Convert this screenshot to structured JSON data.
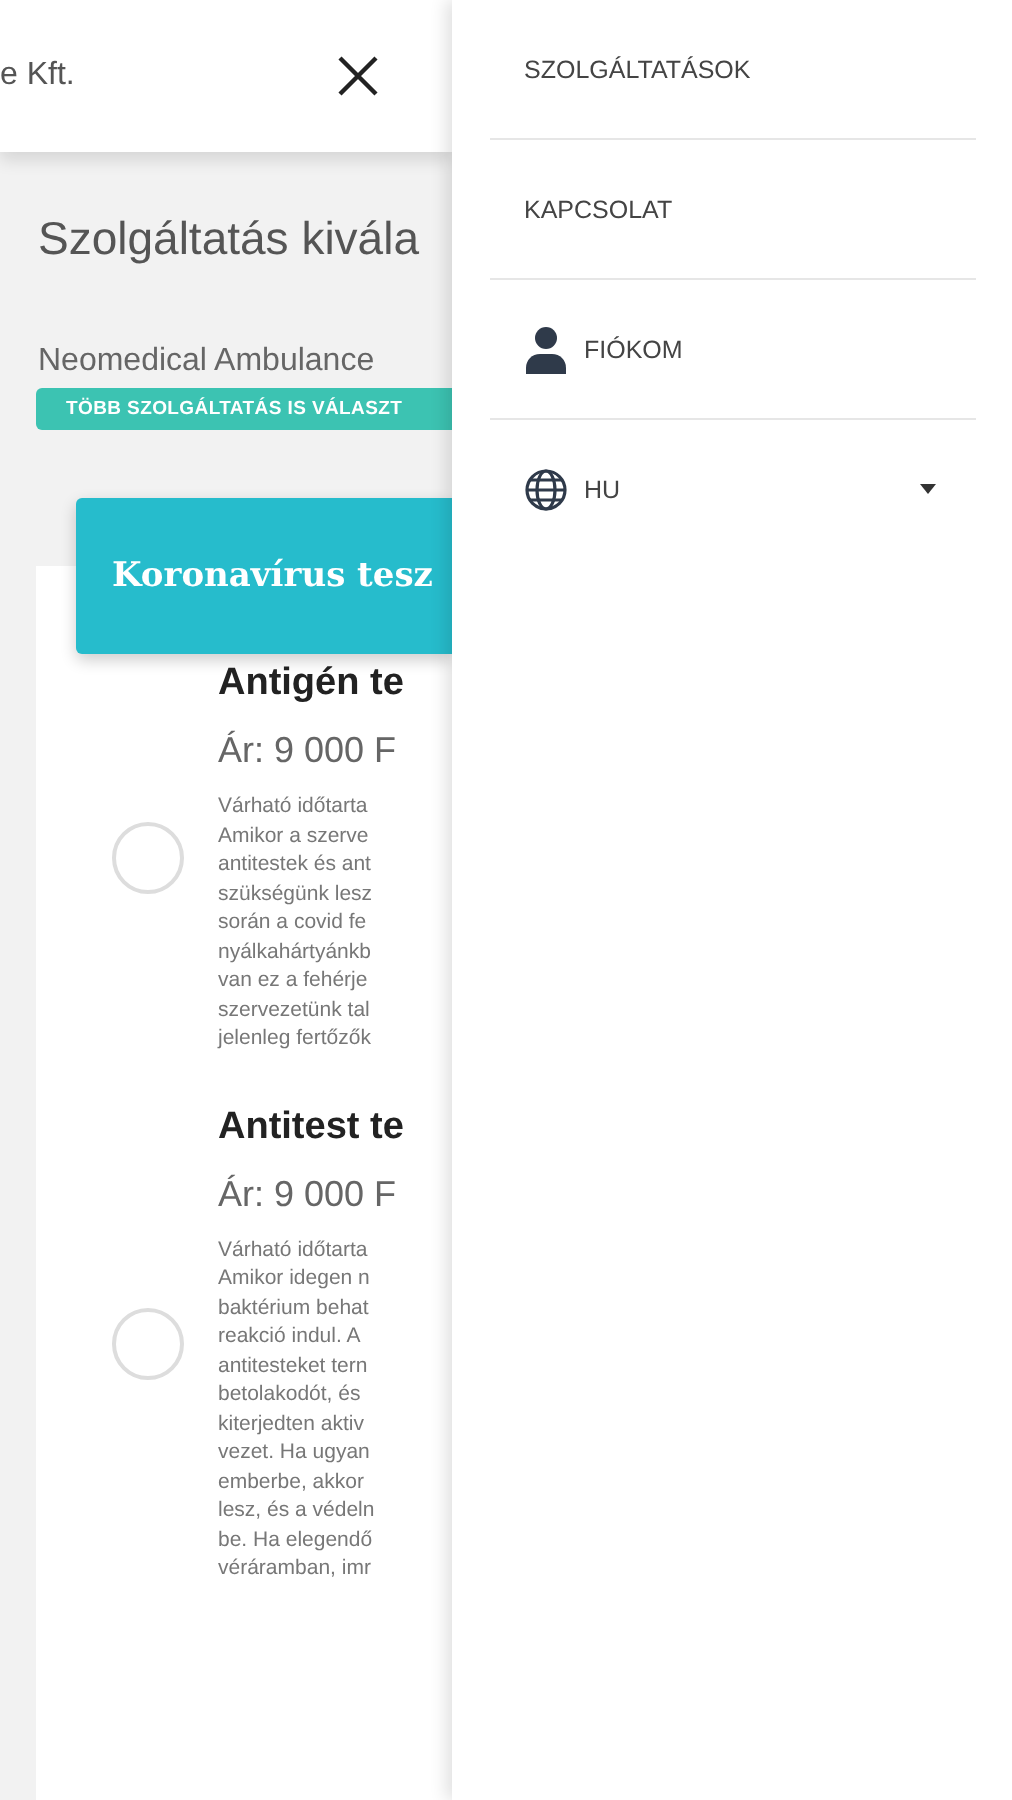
{
  "header": {
    "title": "e Kft."
  },
  "page": {
    "title": "Szolgáltatás kivála",
    "provider": "Neomedical Ambulance",
    "badge": "TÖBB SZOLGÁLTATÁS IS VÁLASZT"
  },
  "category": {
    "title": "Koronavírus tesz"
  },
  "services": [
    {
      "name": "Antigén te",
      "price": "Ár: 9 000 F",
      "selected": false,
      "description_lines": [
        "Várható időtarta",
        "Amikor a szerve",
        "antitestek és ant",
        "szükségünk lesz",
        "során a covid fe",
        "nyálkahártyánkb",
        "van ez a fehérje",
        "szervezetünk tal",
        "jelenleg fertőzők"
      ]
    },
    {
      "name": "Antitest te",
      "price": "Ár: 9 000 F",
      "selected": false,
      "description_lines": [
        "Várható időtarta",
        "Amikor idegen n",
        "baktérium behat",
        "reakció indul. A",
        "antitesteket tern",
        "betolakodót, és",
        "kiterjedten aktiv",
        "vezet. Ha ugyan",
        "emberbe, akkor",
        "lesz, és a védeln",
        "be. Ha elegendő",
        "véráramban, imr"
      ]
    }
  ],
  "drawer": {
    "items": [
      {
        "kind": "plain",
        "label": "SZOLGÁLTATÁSOK"
      },
      {
        "kind": "plain",
        "label": "KAPCSOLAT"
      },
      {
        "kind": "account",
        "label": "FIÓKOM"
      },
      {
        "kind": "language",
        "label": "HU"
      }
    ]
  }
}
